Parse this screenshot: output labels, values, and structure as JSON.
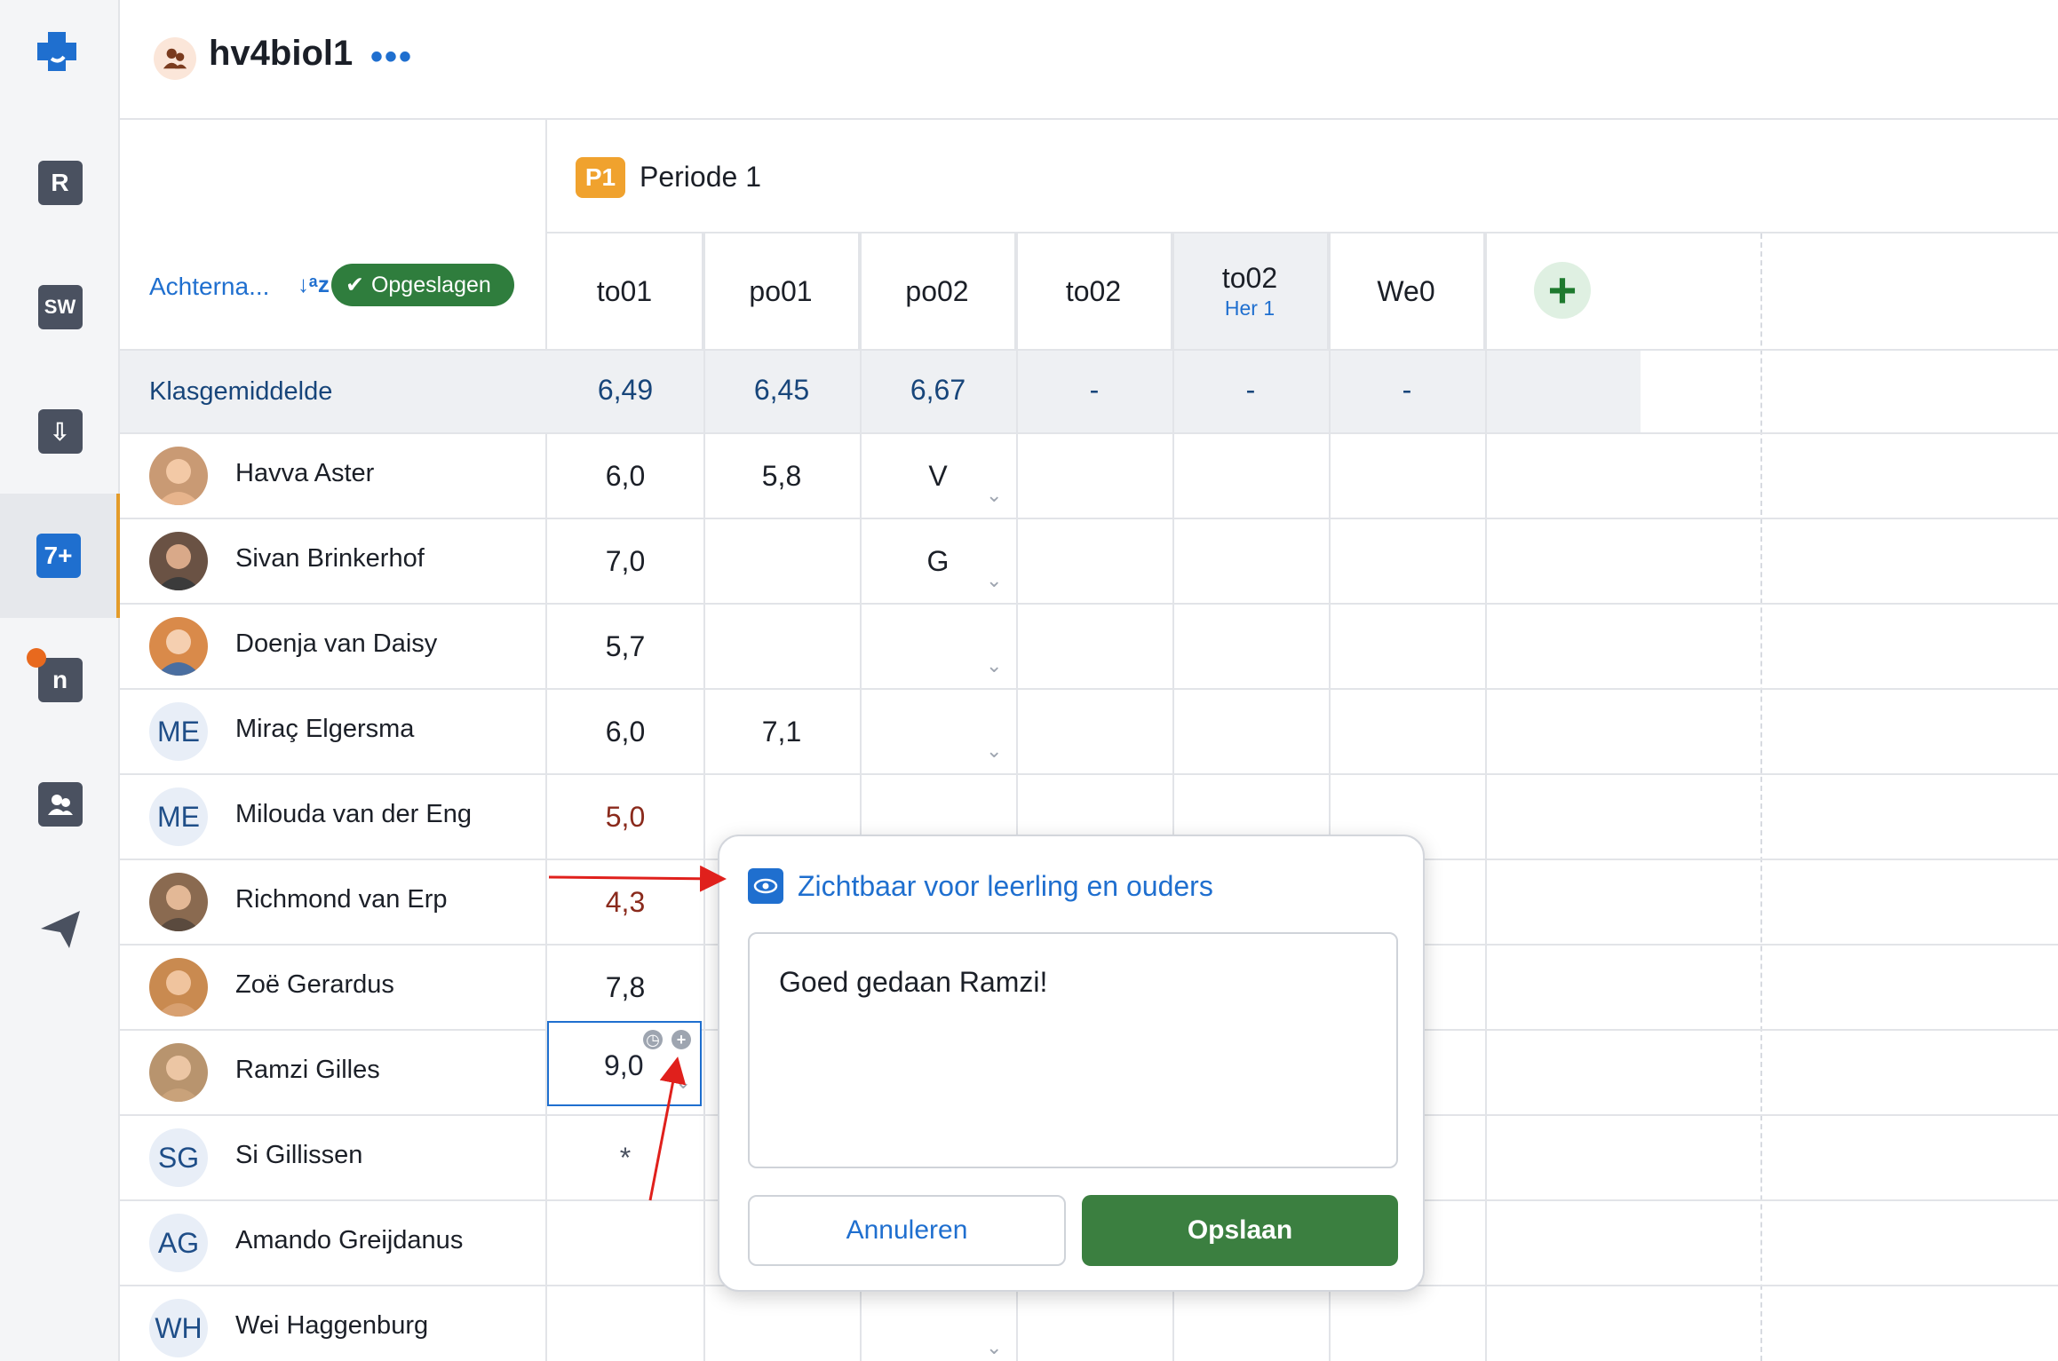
{
  "header": {
    "title": "hv4biol1",
    "more": "•••"
  },
  "sidebar": {
    "items": [
      {
        "name": "roster",
        "label": "R"
      },
      {
        "name": "studiewijzer",
        "label": "SW"
      },
      {
        "name": "inleveren",
        "label": "⇩"
      },
      {
        "name": "cijfers",
        "label": "7+"
      },
      {
        "name": "notes",
        "label": "n"
      },
      {
        "name": "students",
        "label": ""
      },
      {
        "name": "messages",
        "label": ""
      }
    ]
  },
  "table": {
    "period_badge": "P1",
    "period_label": "Periode 1",
    "sort_label": "Achterna...",
    "sort_icon": "↓ᵃz",
    "saved_label": "Opgeslagen",
    "columns": [
      {
        "label": "to01",
        "sub": ""
      },
      {
        "label": "po01",
        "sub": ""
      },
      {
        "label": "po02",
        "sub": ""
      },
      {
        "label": "to02",
        "sub": ""
      },
      {
        "label": "to02",
        "sub": "Her 1"
      },
      {
        "label": "We0",
        "sub": ""
      }
    ],
    "add_column": "+",
    "average_label": "Klasgemiddelde",
    "averages": [
      "6,49",
      "6,45",
      "6,67",
      "-",
      "-",
      "-"
    ],
    "students": [
      {
        "name": "Havva Aster",
        "initials": "",
        "grades": [
          "6,0",
          "5,8",
          "V",
          "",
          "",
          ""
        ]
      },
      {
        "name": "Sivan Brinkerhof",
        "initials": "",
        "grades": [
          "7,0",
          "",
          "G",
          "",
          "",
          ""
        ]
      },
      {
        "name": "Doenja van Daisy",
        "initials": "",
        "grades": [
          "5,7",
          "",
          "",
          "",
          "",
          ""
        ]
      },
      {
        "name": "Miraç Elgersma",
        "initials": "ME",
        "grades": [
          "6,0",
          "7,1",
          "",
          "",
          "",
          ""
        ]
      },
      {
        "name": "Milouda van der Eng",
        "initials": "ME",
        "grades": [
          "5,0",
          "",
          "",
          "",
          "",
          ""
        ]
      },
      {
        "name": "Richmond van Erp",
        "initials": "",
        "grades": [
          "4,3",
          "",
          "",
          "",
          "",
          ""
        ]
      },
      {
        "name": "Zoë Gerardus",
        "initials": "",
        "grades": [
          "7,8",
          "",
          "",
          "",
          "",
          ""
        ]
      },
      {
        "name": "Ramzi Gilles",
        "initials": "",
        "grades": [
          "9,0",
          "",
          "",
          "",
          "",
          ""
        ]
      },
      {
        "name": "Si Gillissen",
        "initials": "SG",
        "grades": [
          "*",
          "",
          "",
          "",
          "",
          ""
        ]
      },
      {
        "name": "Amando Greijdanus",
        "initials": "AG",
        "grades": [
          "",
          "",
          "",
          "",
          "",
          ""
        ]
      },
      {
        "name": "Wei Haggenburg",
        "initials": "WH",
        "grades": [
          "",
          "",
          "",
          "",
          "",
          ""
        ]
      }
    ]
  },
  "popup": {
    "visibility_label": "Zichtbaar voor leerling en ouders",
    "comment_value": "Goed gedaan Ramzi!",
    "cancel_label": "Annuleren",
    "save_label": "Opslaan"
  },
  "colors": {
    "accent": "#1f6fcf",
    "save_green": "#3b7f40",
    "badge_orange": "#f0a22e",
    "low_grade": "#8a2a1c",
    "annotation_arrow": "#e0201c"
  }
}
